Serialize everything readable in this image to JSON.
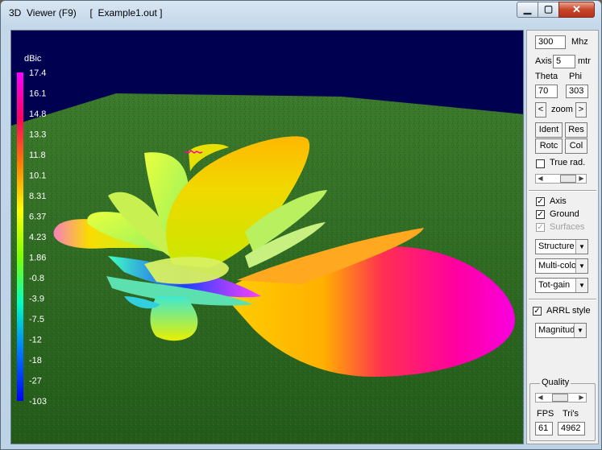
{
  "window": {
    "title": "3D  Viewer (F9)     [  Example1.out ]"
  },
  "legend": {
    "unit": "dBic",
    "values": [
      "17.4",
      "16.1",
      "14.8",
      "13.3",
      "11.8",
      "10.1",
      "8.31",
      "6.37",
      "4.23",
      "1.86",
      "-0.8",
      "-3.9",
      "-7.5",
      "-12",
      "-18",
      "-27",
      "-103"
    ]
  },
  "panel": {
    "frequency_value": "300",
    "frequency_unit": "Mhz",
    "axis_label": "Axis",
    "axis_value": "5",
    "axis_unit": "mtr",
    "theta_label": "Theta",
    "phi_label": "Phi",
    "theta_value": "70",
    "phi_value": "303",
    "zoom_label": "zoom",
    "zoom_prev": "<",
    "zoom_next": ">",
    "ident_label": "Ident",
    "res_label": "Res",
    "rotc_label": "Rotc",
    "col_label": "Col",
    "true_rad_label": "True rad.",
    "true_rad_checked": false,
    "axis_check_label": "Axis",
    "axis_checked": true,
    "ground_label": "Ground",
    "ground_checked": true,
    "surfaces_label": "Surfaces",
    "surfaces_checked": true,
    "display_select": "Structure",
    "color_select": "Multi-colo",
    "gain_select": "Tot-gain",
    "arrl_label": "ARRL style",
    "arrl_checked": true,
    "scale_select": "Magnitud",
    "quality_label": "Quality",
    "fps_label": "FPS",
    "tris_label": "Tri's",
    "fps_value": "61",
    "tris_value": "4962"
  },
  "colors": {
    "sky": "#000050",
    "ground": "#2f6a24",
    "accent_magenta": "#ff00c8"
  }
}
